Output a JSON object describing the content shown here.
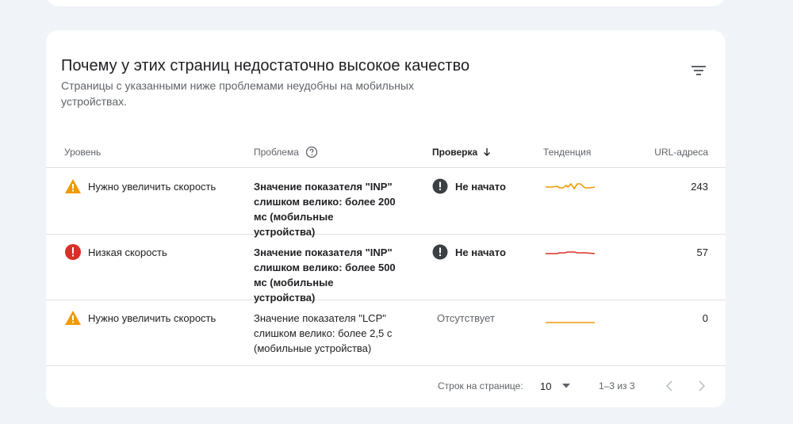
{
  "card": {
    "title": "Почему у этих страниц недостаточно высокое качество",
    "subtitle": "Страницы с указанными ниже проблемами неудобны на мобильных устройствах."
  },
  "table": {
    "headers": {
      "level": "Уровень",
      "problem": "Проблема",
      "check": "Проверка",
      "trend": "Тенденция",
      "urls": "URL-адреса"
    },
    "rows": [
      {
        "level": "Нужно увеличить скорость",
        "level_icon": "warning-icon",
        "problem": "Значение показателя \"INP\" слишком велико: более 200 мс (мобильные устройства)",
        "check": "Не начато",
        "trend_color": "#f29900",
        "count": "243"
      },
      {
        "level": "Низкая скорость",
        "level_icon": "error-icon",
        "problem": "Значение показателя \"INP\" слишком велико: более 500 мс (мобильные устройства)",
        "check": "Не начато",
        "trend_color": "#d93025",
        "count": "57"
      },
      {
        "level": "Нужно увеличить скорость",
        "level_icon": "warning-icon",
        "problem": "Значение показателя \"LCP\" слишком велико: более 2,5 с (мобильные устройства)",
        "check": "Отсутствует",
        "trend_color": "#f29900",
        "count": "0"
      }
    ]
  },
  "pager": {
    "rows_label": "Строк на странице:",
    "rows_value": "10",
    "range": "1–3 из 3"
  },
  "colors": {
    "warning": "#f29900",
    "error": "#d93025",
    "status_dark": "#3c4043"
  }
}
